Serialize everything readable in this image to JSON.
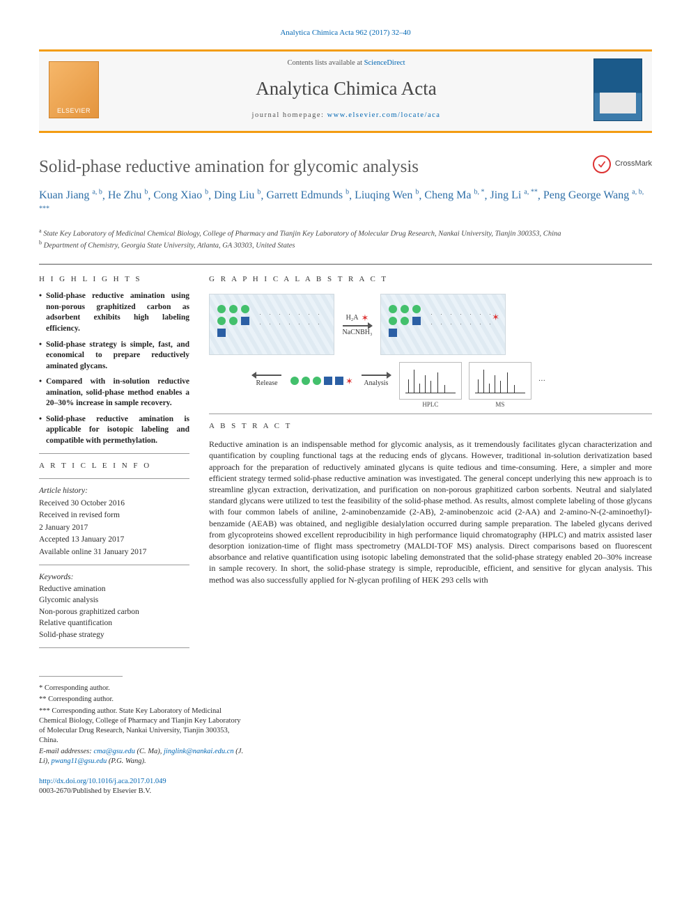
{
  "top_citation": "Analytica Chimica Acta 962 (2017) 32–40",
  "banner": {
    "publisher_logo_label": "ELSEVIER",
    "contents_prefix": "Contents lists available at ",
    "contents_link": "ScienceDirect",
    "journal_name": "Analytica Chimica Acta",
    "homepage_prefix": "journal homepage: ",
    "homepage_url": "www.elsevier.com/locate/aca"
  },
  "crossmark_label": "CrossMark",
  "title": "Solid-phase reductive amination for glycomic analysis",
  "authors_raw": [
    {
      "name": "Kuan Jiang",
      "aff": "a, b"
    },
    {
      "name": "He Zhu",
      "aff": "b"
    },
    {
      "name": "Cong Xiao",
      "aff": "b"
    },
    {
      "name": "Ding Liu",
      "aff": "b"
    },
    {
      "name": "Garrett Edmunds",
      "aff": "b"
    },
    {
      "name": "Liuqing Wen",
      "aff": "b"
    },
    {
      "name": "Cheng Ma",
      "aff": "b, *"
    },
    {
      "name": "Jing Li",
      "aff": "a, **"
    },
    {
      "name": "Peng George Wang",
      "aff": "a, b, ***"
    }
  ],
  "affiliations": [
    {
      "sup": "a",
      "text": "State Key Laboratory of Medicinal Chemical Biology, College of Pharmacy and Tianjin Key Laboratory of Molecular Drug Research, Nankai University, Tianjin 300353, China"
    },
    {
      "sup": "b",
      "text": "Department of Chemistry, Georgia State University, Atlanta, GA 30303, United States"
    }
  ],
  "sections": {
    "highlights_head": "H I G H L I G H T S",
    "graphical_head": "G R A P H I C A L  A B S T R A C T",
    "article_info_head": "A R T I C L E  I N F O",
    "abstract_head": "A B S T R A C T",
    "keywords_head": "Keywords:"
  },
  "highlights": [
    "Solid-phase reductive amination using non-porous graphitized carbon as adsorbent exhibits high labeling efficiency.",
    "Solid-phase strategy is simple, fast, and economical to prepare reductively aminated glycans.",
    "Compared with in-solution reductive amination, solid-phase method enables a 20–30% increase in sample recovery.",
    "Solid-phase reductive amination is applicable for isotopic labeling and compatible with permethylation."
  ],
  "article_info": {
    "history_label": "Article history:",
    "lines": [
      "Received 30 October 2016",
      "Received in revised form",
      "2 January 2017",
      "Accepted 13 January 2017",
      "Available online 31 January 2017"
    ]
  },
  "keywords": [
    "Reductive amination",
    "Glycomic analysis",
    "Non-porous graphitized carbon",
    "Relative quantification",
    "Solid-phase strategy"
  ],
  "graphical_abstract": {
    "reagent_top": "H₂A",
    "reagent_bottom": "NaCNBH₃",
    "release_label": "Release",
    "analysis_label": "Analysis",
    "spec1": "HPLC",
    "spec2": "MS",
    "ellipsis": "···"
  },
  "abstract_text": "Reductive amination is an indispensable method for glycomic analysis, as it tremendously facilitates glycan characterization and quantification by coupling functional tags at the reducing ends of glycans. However, traditional in-solution derivatization based approach for the preparation of reductively aminated glycans is quite tedious and time-consuming. Here, a simpler and more efficient strategy termed solid-phase reductive amination was investigated. The general concept underlying this new approach is to streamline glycan extraction, derivatization, and purification on non-porous graphitized carbon sorbents. Neutral and sialylated standard glycans were utilized to test the feasibility of the solid-phase method. As results, almost complete labeling of those glycans with four common labels of aniline, 2-aminobenzamide (2-AB), 2-aminobenzoic acid (2-AA) and 2-amino-N-(2-aminoethyl)-benzamide (AEAB) was obtained, and negligible desialylation occurred during sample preparation. The labeled glycans derived from glycoproteins showed excellent reproducibility in high performance liquid chromatography (HPLC) and matrix assisted laser desorption ionization-time of flight mass spectrometry (MALDI-TOF MS) analysis. Direct comparisons based on fluorescent absorbance and relative quantification using isotopic labeling demonstrated that the solid-phase strategy enabled 20–30% increase in sample recovery. In short, the solid-phase strategy is simple, reproducible, efficient, and sensitive for glycan analysis. This method was also successfully applied for N-glycan profiling of HEK 293 cells with",
  "footnotes": {
    "f1": "* Corresponding author.",
    "f2": "** Corresponding author.",
    "f3_prefix": "*** Corresponding author. ",
    "f3_body": "State Key Laboratory of Medicinal Chemical Biology, College of Pharmacy and Tianjin Key Laboratory of Molecular Drug Research, Nankai University, Tianjin 300353, China.",
    "emails_label": "E-mail addresses:",
    "emails": [
      {
        "addr": "cma@gsu.edu",
        "who": "(C. Ma)"
      },
      {
        "addr": "jinglink@nankai.edu.cn",
        "who": "(J. Li)"
      },
      {
        "addr": "pwang11@gsu.edu",
        "who": "(P.G. Wang)."
      }
    ]
  },
  "doi": {
    "url": "http://dx.doi.org/10.1016/j.aca.2017.01.049",
    "issn_line": "0003-2670/Published by Elsevier B.V."
  }
}
